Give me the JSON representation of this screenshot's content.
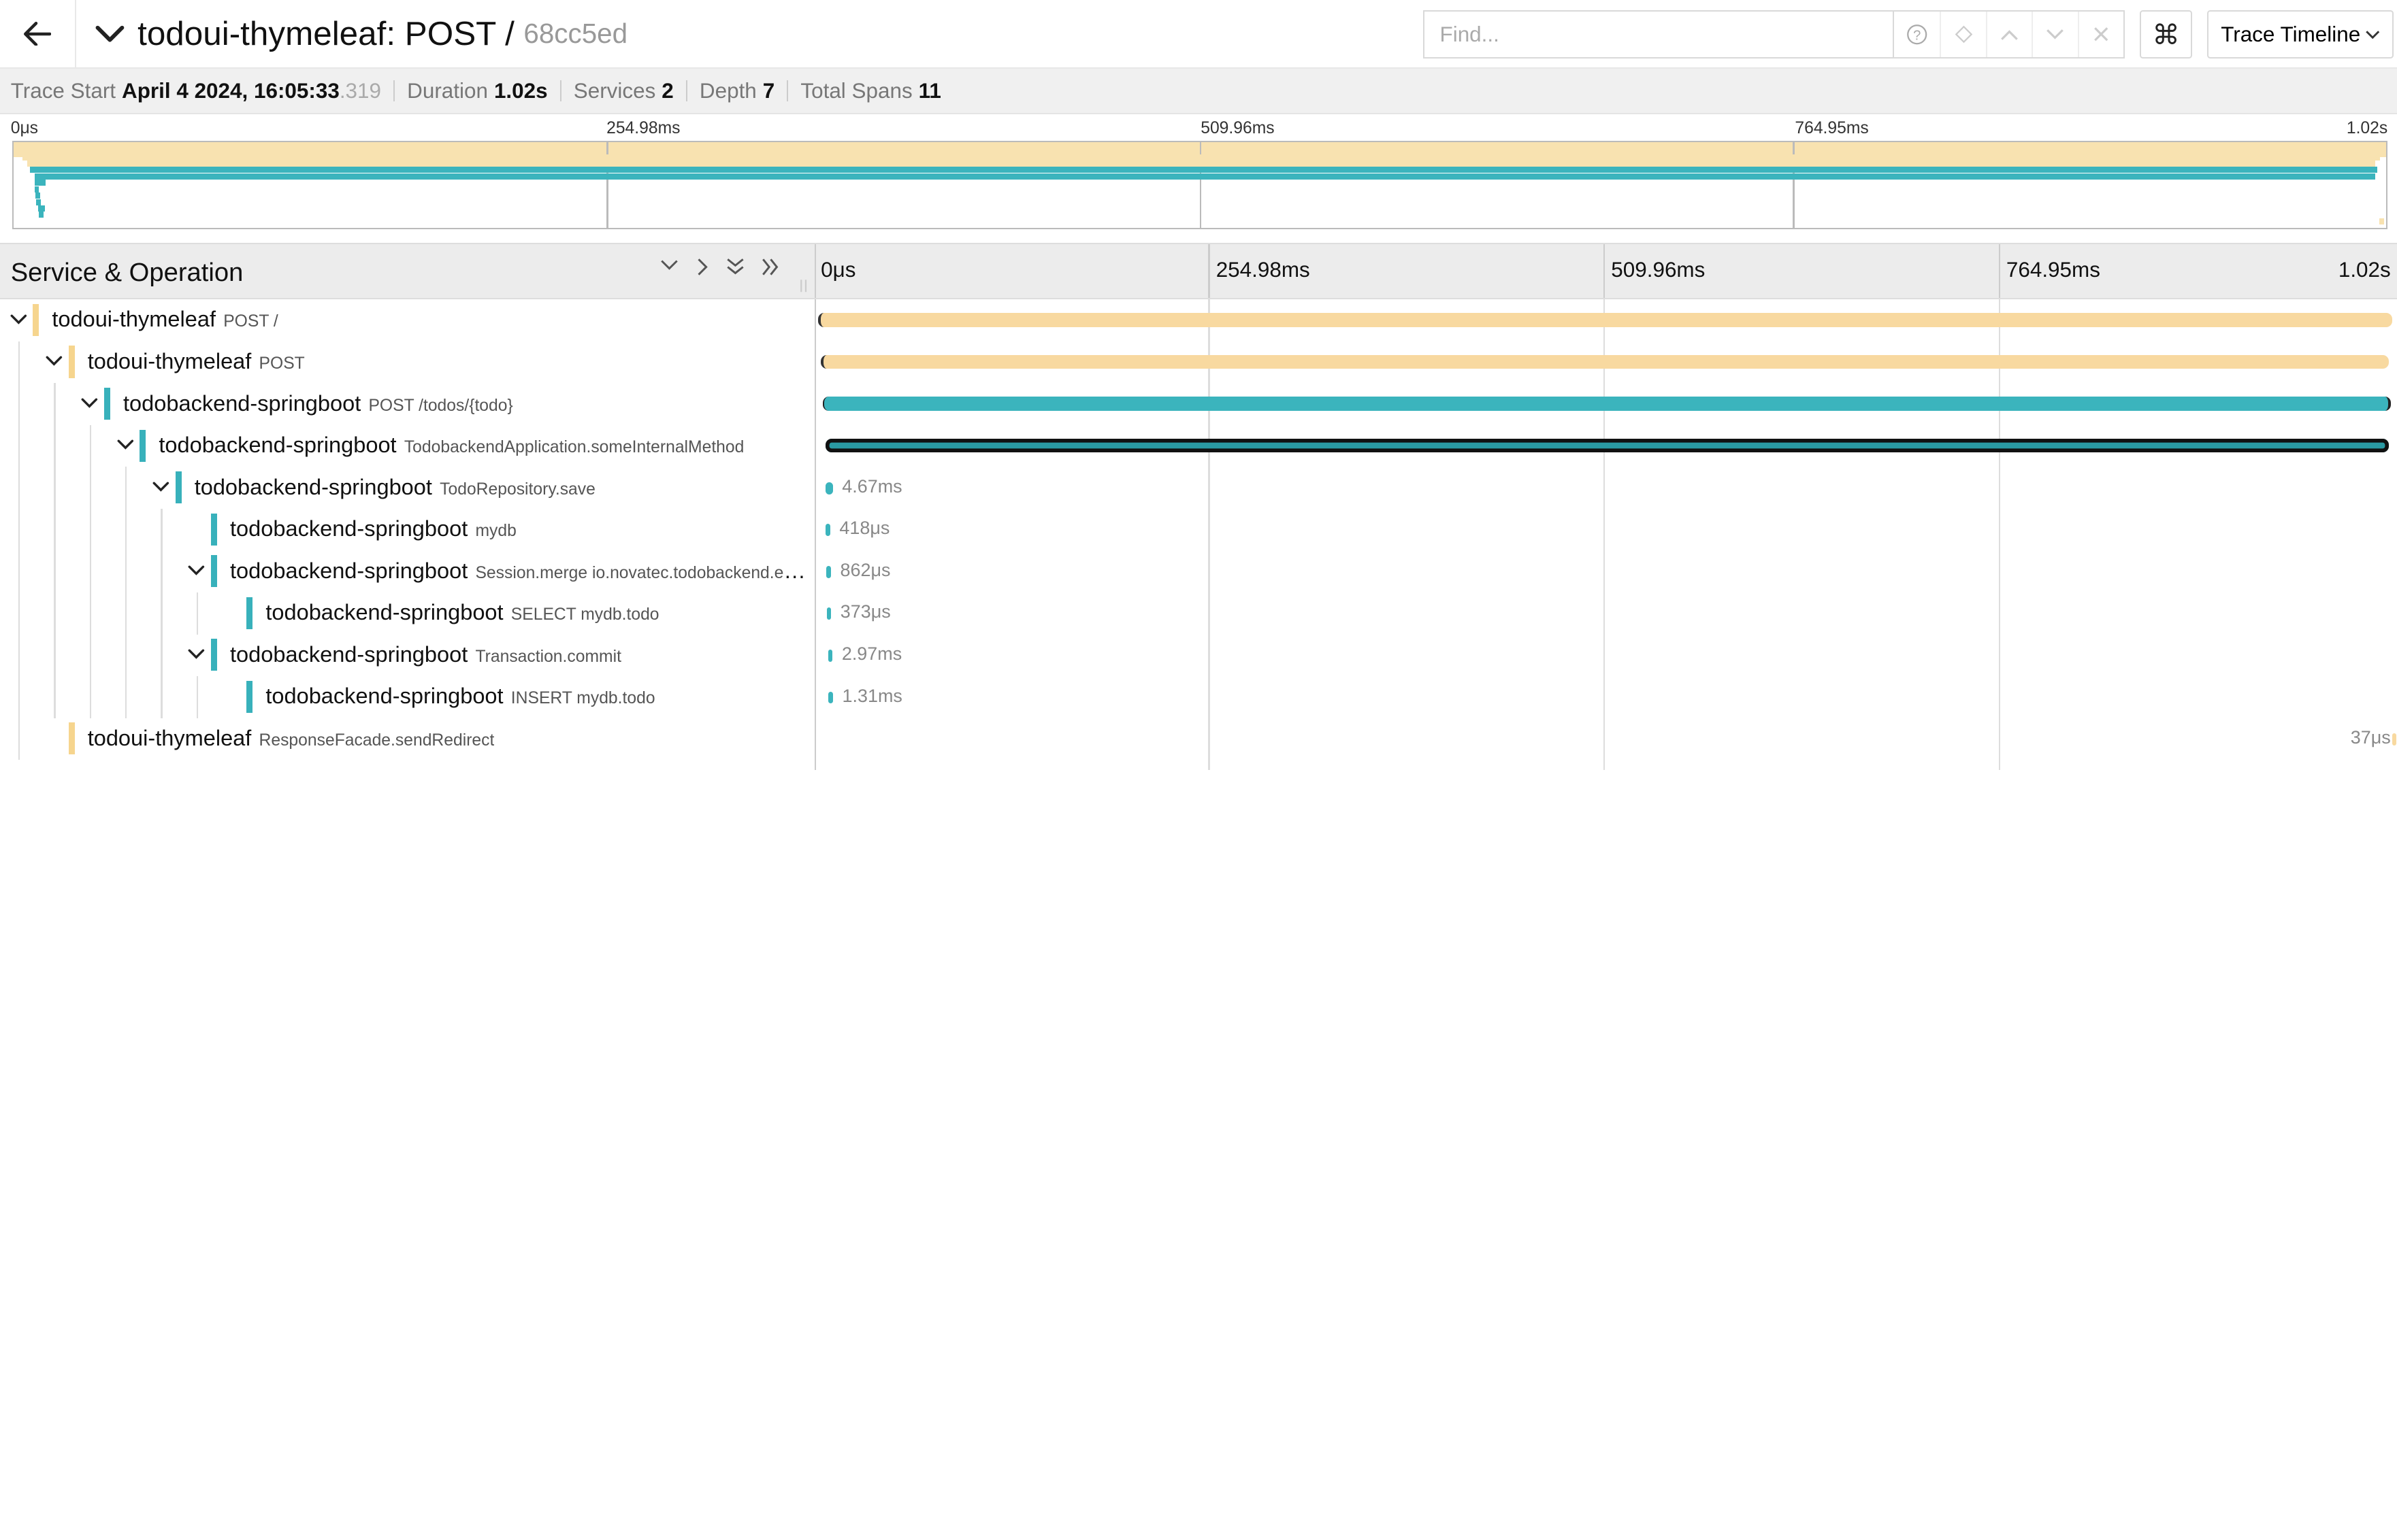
{
  "header": {
    "title": "todoui-thymeleaf: POST /",
    "trace_id": "68cc5ed",
    "search_placeholder": "Find...",
    "view_select": "Trace Timeline"
  },
  "overview": {
    "trace_start_label": "Trace Start",
    "trace_start_value": "April 4 2024, 16:05:33",
    "trace_start_ms": ".319",
    "duration_label": "Duration",
    "duration_value": "1.02s",
    "services_label": "Services",
    "services_value": "2",
    "depth_label": "Depth",
    "depth_value": "7",
    "total_spans_label": "Total Spans",
    "total_spans_value": "11"
  },
  "ticks": [
    "0μs",
    "254.98ms",
    "509.96ms",
    "764.95ms",
    "1.02s"
  ],
  "timeline": {
    "left_title": "Service & Operation"
  },
  "colors": {
    "ui_service": "#f8d9a0",
    "backend_service": "#3bb4bd",
    "ui_marker": "#f6d58e",
    "backend_marker": "#38b1bb"
  },
  "spans": [
    {
      "service": "todoui-thymeleaf",
      "op": "POST /",
      "depth": 0,
      "collapsible": true,
      "svc": "ui",
      "start": 0.0,
      "end": 1.0,
      "label": ""
    },
    {
      "service": "todoui-thymeleaf",
      "op": "POST",
      "depth": 1,
      "collapsible": true,
      "svc": "ui",
      "start": 0.002,
      "end": 0.998,
      "label": ""
    },
    {
      "service": "todobackend-springboot",
      "op": "POST /todos/{todo}",
      "depth": 2,
      "collapsible": true,
      "svc": "backend",
      "start": 0.003,
      "end": 0.999,
      "label": ""
    },
    {
      "service": "todobackend-springboot",
      "op": "TodobackendApplication.someInternalMethod",
      "depth": 3,
      "collapsible": true,
      "svc": "backend",
      "start": 0.005,
      "end": 0.998,
      "label": ""
    },
    {
      "service": "todobackend-springboot",
      "op": "TodoRepository.save",
      "depth": 4,
      "collapsible": true,
      "svc": "backend",
      "start": 0.005,
      "end": 0.0096,
      "label": "4.67ms"
    },
    {
      "service": "todobackend-springboot",
      "op": "mydb",
      "depth": 5,
      "collapsible": false,
      "svc": "backend",
      "start": 0.005,
      "end": 0.0054,
      "label": "418μs"
    },
    {
      "service": "todobackend-springboot",
      "op": "Session.merge io.novatec.todobackend.entities.Todo",
      "depth": 5,
      "collapsible": true,
      "svc": "backend",
      "start": 0.0055,
      "end": 0.0064,
      "label": "862μs"
    },
    {
      "service": "todobackend-springboot",
      "op": "SELECT mydb.todo",
      "depth": 6,
      "collapsible": false,
      "svc": "backend",
      "start": 0.0056,
      "end": 0.006,
      "label": "373μs"
    },
    {
      "service": "todobackend-springboot",
      "op": "Transaction.commit",
      "depth": 5,
      "collapsible": true,
      "svc": "backend",
      "start": 0.0065,
      "end": 0.0094,
      "label": "2.97ms"
    },
    {
      "service": "todobackend-springboot",
      "op": "INSERT mydb.todo",
      "depth": 6,
      "collapsible": false,
      "svc": "backend",
      "start": 0.0068,
      "end": 0.0081,
      "label": "1.31ms"
    },
    {
      "service": "todoui-thymeleaf",
      "op": "ResponseFacade.sendRedirect",
      "depth": 1,
      "collapsible": false,
      "svc": "ui",
      "start": 0.9999,
      "end": 1.0,
      "label": "37μs"
    }
  ]
}
